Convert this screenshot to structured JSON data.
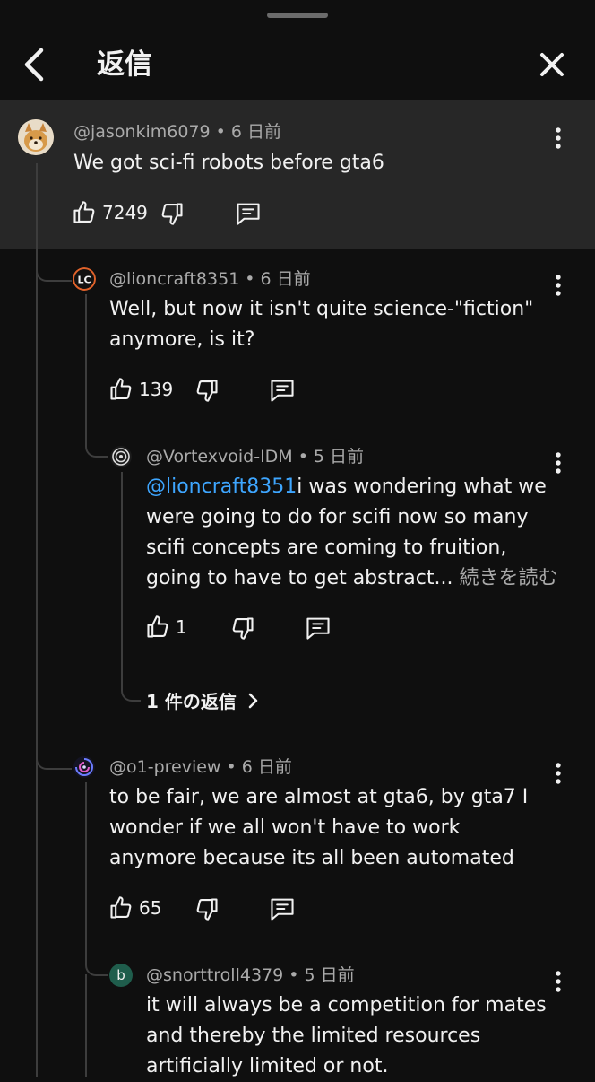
{
  "header": {
    "title": "返信",
    "back_icon": "chevron-left-icon",
    "close_icon": "close-icon"
  },
  "comments": [
    {
      "handle": "@jasonkim6079",
      "time": "6 日前",
      "text": "We got sci-fi robots before gta6",
      "likes": "7249"
    },
    {
      "handle": "@lioncraft8351",
      "time": "6 日前",
      "text": "Well, but now it isn't quite science-\"fiction\" anymore, is it?",
      "likes": "139"
    },
    {
      "handle": "@Vortexvoid-IDM",
      "time": "5 日前",
      "mention": "@lioncraft8351",
      "text": "i was wondering what we were going to do for scifi now so many scifi concepts are coming to fruition, going to have to get abstract...",
      "read_more": "続きを読む",
      "likes": "1",
      "replies_link": "1 件の返信"
    },
    {
      "handle": "@o1-preview",
      "time": "6 日前",
      "text": "to be fair, we are almost at gta6, by gta7 I wonder if we all won't have to work anymore because its all been automated",
      "likes": "65"
    },
    {
      "handle": "@snorttroll4379",
      "time": "5 日前",
      "avatar_letter": "b",
      "text": "it will always be a competition for mates and thereby the limited resources artificially limited or not."
    }
  ],
  "colors": {
    "background": "#0f0f0f",
    "highlight": "#272727",
    "mention": "#3ea6ff",
    "secondary_text": "#aaaaaa"
  }
}
